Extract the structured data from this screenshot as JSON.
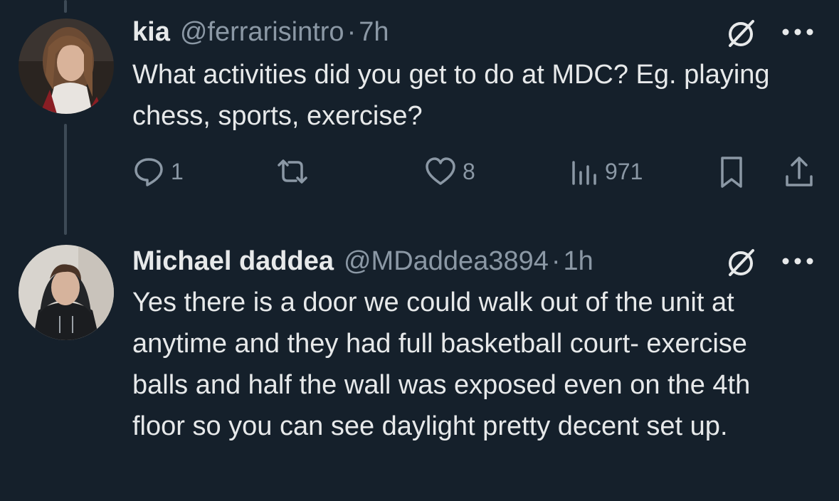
{
  "thread": [
    {
      "author": {
        "name": "kia",
        "handle": "@ferrarisintro",
        "separator": "·",
        "time": "7h"
      },
      "text": "What activities did you get to do at MDC? Eg. playing chess, sports, exercise?",
      "actions": {
        "replies": "1",
        "likes": "8",
        "views": "971"
      }
    },
    {
      "author": {
        "name": "Michael daddea",
        "handle": "@MDaddea3894",
        "separator": "·",
        "time": "1h"
      },
      "text": "Yes there is a door we could walk out of the unit at anytime and they had full basketball court- exercise balls and half the wall was exposed even on the 4th floor so you can see daylight pretty decent set up."
    }
  ],
  "icons": {
    "reply": "reply-icon",
    "retweet": "retweet-icon",
    "like": "heart-icon",
    "views": "views-icon",
    "bookmark": "bookmark-icon",
    "share": "share-icon",
    "grok": "grok-icon",
    "more": "more-icon"
  },
  "colors": {
    "background": "#15202b",
    "text": "#e7e9ea",
    "secondary": "#8b98a5",
    "thread_line": "#3d4a56"
  }
}
